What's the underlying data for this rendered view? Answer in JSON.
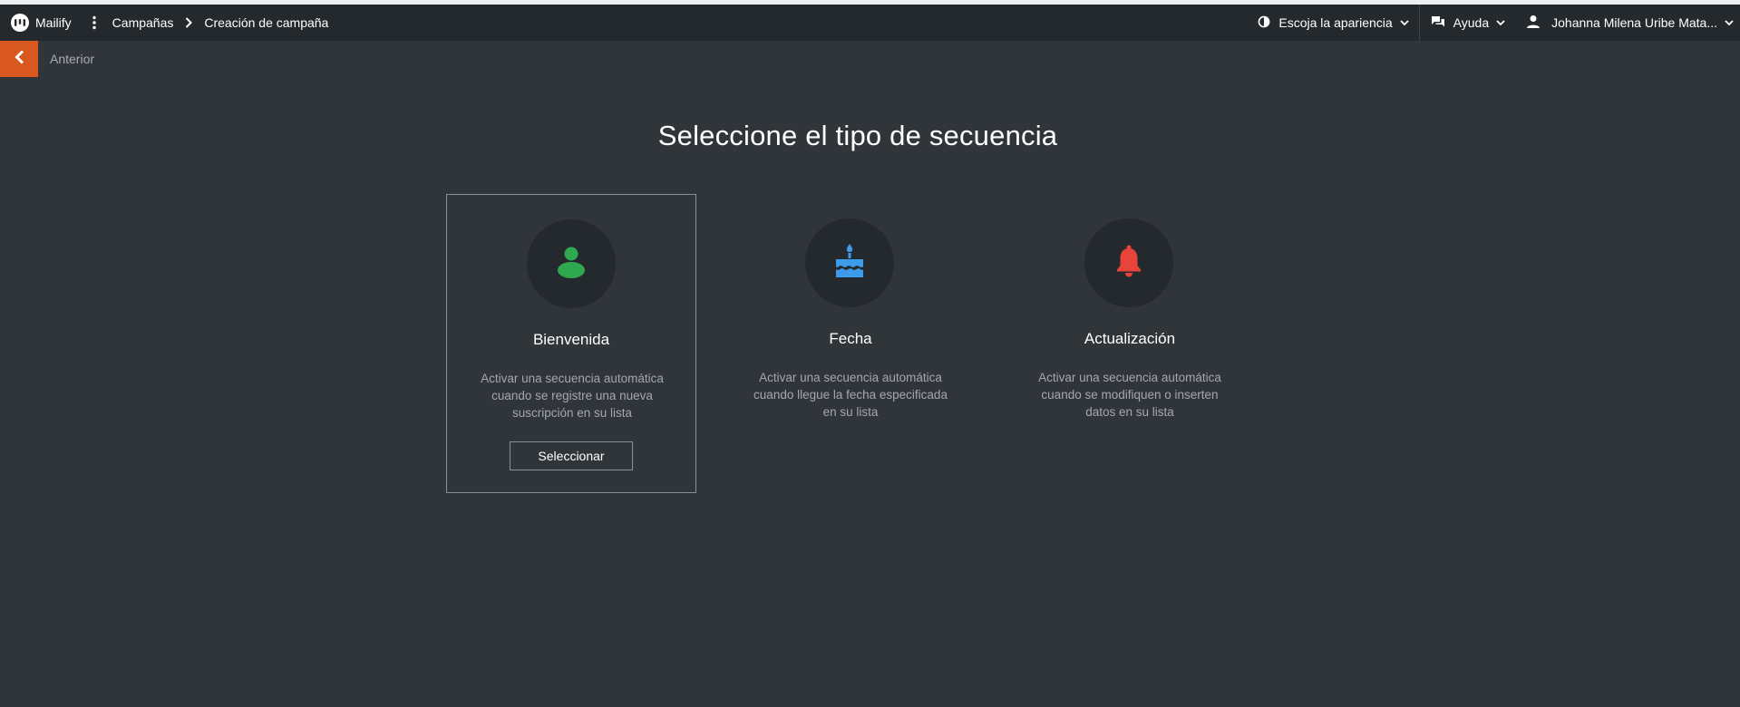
{
  "app": {
    "brand": "Mailify",
    "breadcrumb": [
      "Campañas",
      "Creación de campaña"
    ]
  },
  "topbar": {
    "appearance_label": "Escoja la apariencia",
    "help_label": "Ayuda",
    "user_name": "Johanna Milena Uribe Mata..."
  },
  "nav": {
    "back_label": "Anterior"
  },
  "page": {
    "title": "Seleccione el tipo de secuencia"
  },
  "cards": [
    {
      "name": "Bienvenida",
      "description": "Activar una secuencia automática cuando se registre una nueva suscripción en su lista",
      "icon": "person-icon",
      "icon_color": "#2fa84f",
      "button_label": "Seleccionar",
      "selected": true
    },
    {
      "name": "Fecha",
      "description": "Activar una secuencia automática cuando llegue la fecha especificada en su lista",
      "icon": "cake-icon",
      "icon_color": "#3d9be9",
      "selected": false
    },
    {
      "name": "Actualización",
      "description": "Activar una secuencia automática cuando se modifiquen o inserten datos en su lista",
      "icon": "bell-icon",
      "icon_color": "#e8443a",
      "selected": false
    }
  ],
  "colors": {
    "background": "#30353a",
    "topbar": "#24292d",
    "accent": "#d8581f"
  }
}
